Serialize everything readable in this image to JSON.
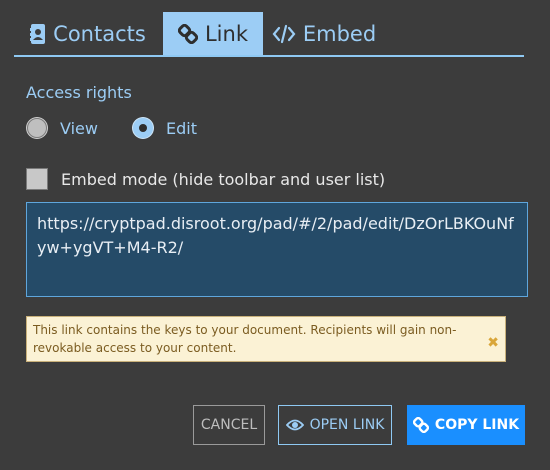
{
  "tabs": {
    "contacts": "Contacts",
    "link": "Link",
    "embed": "Embed"
  },
  "access": {
    "label": "Access rights",
    "view": "View",
    "edit": "Edit",
    "selected": "Edit"
  },
  "embed_mode": {
    "label": "Embed mode (hide toolbar and user list)",
    "checked": false
  },
  "link": {
    "url": "https://cryptpad.disroot.org/pad/#/2/pad/edit/DzOrLBKOuNfyw+ygVT+M4-R2/"
  },
  "warning": {
    "text": "This link contains the keys to your document. Recipients will gain non-revokable access to your content."
  },
  "buttons": {
    "cancel": "CANCEL",
    "open": "OPEN LINK",
    "copy": "COPY LINK"
  },
  "colors": {
    "background": "#3c3c3c",
    "accent": "#9ccdf5",
    "primary_button": "#1a8fff",
    "url_bg": "#254b68",
    "warning_bg": "#fbf2d5"
  },
  "icons": {
    "contacts": "address-book-icon",
    "link": "link-icon",
    "embed": "code-icon",
    "open": "eye-icon",
    "copy": "link-icon",
    "close": "close-icon"
  }
}
